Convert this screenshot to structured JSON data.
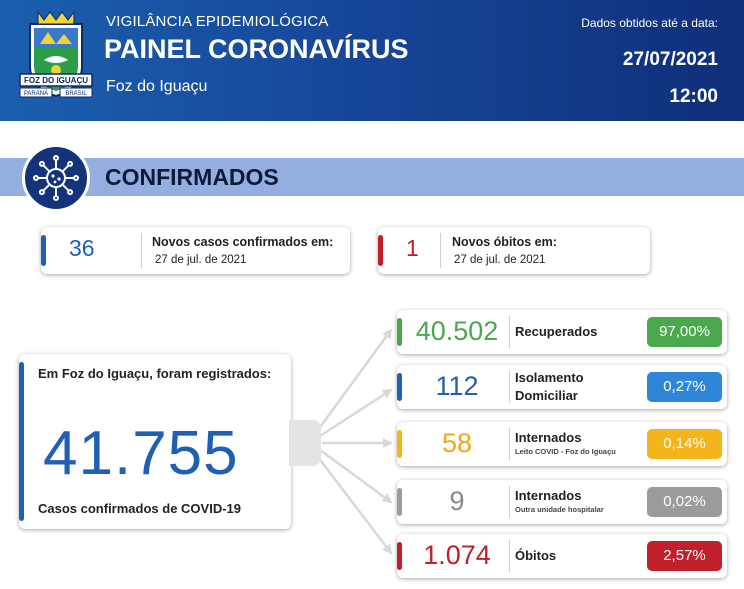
{
  "header": {
    "subtitle": "VIGILÂNCIA EPIDEMIOLÓGICA",
    "title": "PAINEL CORONAVÍRUS",
    "city": "Foz do Iguaçu",
    "date_label": "Dados obtidos até a data:",
    "date": "27/07/2021",
    "time": "12:00",
    "crest": {
      "banner_text": "FOZ DO IGUAÇU",
      "left_ribbon": "PARANÁ",
      "right_ribbon": "BRASIL"
    }
  },
  "section": {
    "title": "CONFIRMADOS",
    "icon": "virus-icon"
  },
  "new_cases": {
    "value": "36",
    "label": "Novos casos confirmados em:",
    "date": "27 de jul. de 2021",
    "color": "#1f5fb4"
  },
  "new_deaths": {
    "value": "1",
    "label": "Novos óbitos em:",
    "date": "27 de jul. de 2021",
    "color": "#c0202a"
  },
  "total": {
    "intro": "Em Foz do Iguaçu, foram registrados:",
    "value": "41.755",
    "label": "Casos confirmados de COVID-19"
  },
  "outcomes": [
    {
      "value": "40.502",
      "label": "Recuperados",
      "sublabel": "",
      "percent": "97,00%",
      "color": "#4aa84e",
      "num_color": "#4aa84e"
    },
    {
      "value": "112",
      "label": "Isolamento",
      "label2": "Domiciliar",
      "sublabel": "",
      "percent": "0,27%",
      "color": "#2f86d9",
      "num_color": "#1f5fb4"
    },
    {
      "value": "58",
      "label": "Internados",
      "sublabel": "Leito COVID - Foz do Iguaçu",
      "percent": "0,14%",
      "color": "#f5b41c",
      "num_color": "#f0a818"
    },
    {
      "value": "9",
      "label": "Internados",
      "sublabel": "Outra unidade hospitalar",
      "percent": "0,02%",
      "color": "#9b9b9b",
      "num_color": "#8a8a8a"
    },
    {
      "value": "1.074",
      "label": "Óbitos",
      "sublabel": "",
      "percent": "2,57%",
      "color": "#c0202a",
      "num_color": "#c0202a"
    }
  ]
}
